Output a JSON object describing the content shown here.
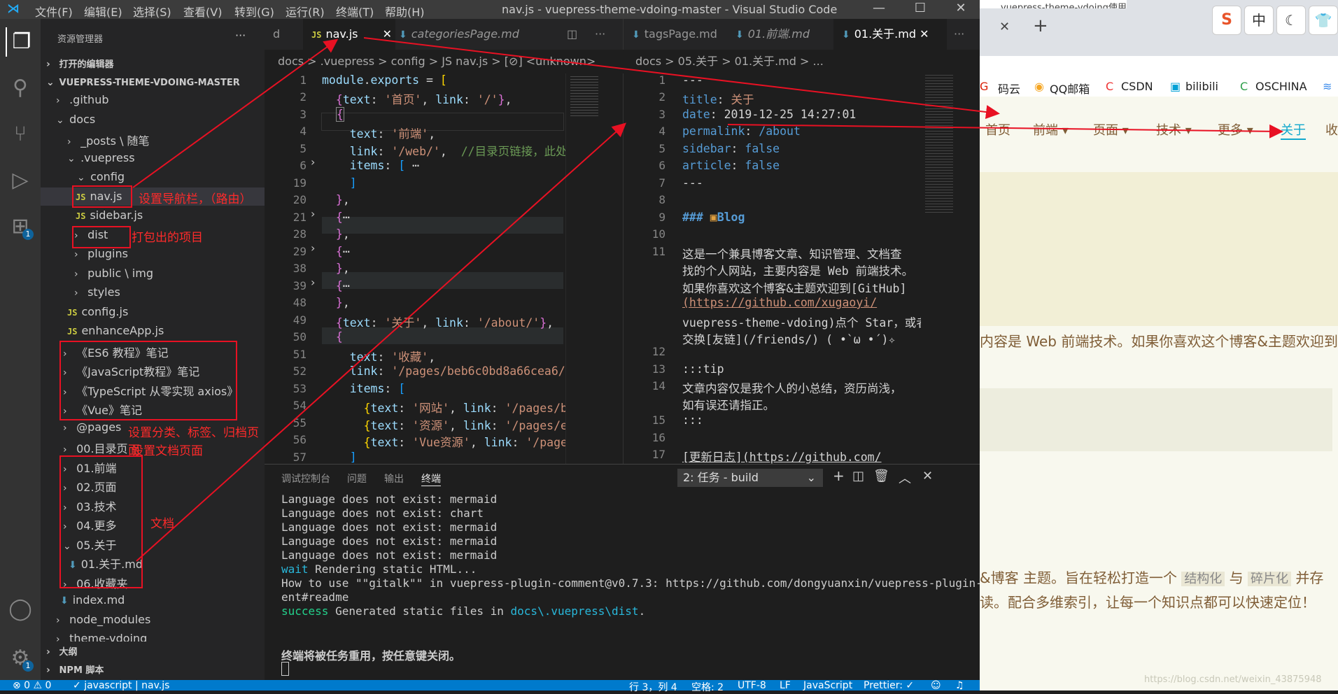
{
  "titlebar": {
    "menu": [
      "文件(F)",
      "编辑(E)",
      "选择(S)",
      "查看(V)",
      "转到(G)",
      "运行(R)",
      "终端(T)",
      "帮助(H)"
    ],
    "title": "nav.js - vuepress-theme-vdoing-master - Visual Studio Code"
  },
  "activity": {
    "icons": [
      "files-icon",
      "search-icon",
      "source-control-icon",
      "run-debug-icon",
      "extensions-icon",
      "account-icon",
      "settings-icon"
    ],
    "ext_badge": "1",
    "settings_badge": "1"
  },
  "sidebar": {
    "header": "资源管理器",
    "more": "···",
    "open_editors": "打开的编辑器",
    "root": "VUEPRESS-THEME-VDOING-MASTER",
    "items": [
      ".github",
      "docs",
      "_posts \\ 随笔",
      ".vuepress",
      "config",
      "nav.js",
      "sidebar.js",
      "dist",
      "plugins",
      "public \\ img",
      "styles",
      "config.js",
      "enhanceApp.js",
      "《ES6 教程》笔记",
      "《JavaScript教程》笔记",
      "《TypeScript 从零实现 axios》",
      "《Vue》笔记",
      "@pages",
      "00.目录页",
      "01.前端",
      "02.页面",
      "03.技术",
      "04.更多",
      "05.关于",
      "01.关于.md",
      "06.收藏夹",
      "index.md",
      "node_modules",
      "theme-vdoing"
    ],
    "outline": "大纲",
    "npm": "NPM 脚本"
  },
  "annotations": {
    "nav": "设置导航栏，（路由）",
    "dist": "打包出的项目",
    "pages": "设置分类、标签、归档页面",
    "catalog": "设置文档页面",
    "docs": "文档"
  },
  "editor1": {
    "tabs": [
      "d",
      "nav.js",
      "categoriesPage.md"
    ],
    "breadcrumb": "docs > .vuepress > config > JS nav.js > [⊘] <unknown>",
    "line_numbers": [
      "1",
      "2",
      "3",
      "4",
      "5",
      "6",
      "19",
      "20",
      "21",
      "28",
      "29",
      "38",
      "39",
      "48",
      "49",
      "50",
      "51",
      "52",
      "53",
      "54",
      "55",
      "56",
      "57"
    ]
  },
  "editor2": {
    "tabs": [
      "tagsPage.md",
      "01.前端.md",
      "01.关于.md"
    ],
    "breadcrumb": "docs > 05.关于 > 01.关于.md > ...",
    "line_numbers": [
      "1",
      "2",
      "3",
      "4",
      "5",
      "6",
      "7",
      "8",
      "9",
      "10",
      "11",
      "",
      "",
      "",
      "",
      "12",
      "13",
      "14",
      "",
      "15",
      "16",
      "17"
    ],
    "md": {
      "title": "关于",
      "date": "2019-12-25 14:27:01",
      "permalink": "/about",
      "heading": "Blog",
      "p1": "这是一个兼具博客文章、知识管理、文档查",
      "p2": "找的个人网站，主要内容是 Web 前端技术。",
      "p3": "如果你喜欢这个博客&主题欢迎到[GitHub]",
      "p4": "(https://github.com/xugaoyi/",
      "p5": "vuepress-theme-vdoing)点个 Star，或者",
      "p6": "交换[友链](/friends/) ( •̀ ω •́ )✧",
      "tip": ":::tip",
      "tip1": "文章内容仅是我个人的小总结，资历尚浅，",
      "tip2": "如有误还请指正。",
      "tipend": ":::",
      "log": "[更新日志](https://github.com/",
      "log2": "xugaoyi/vuepress-theme-vdoing/"
    }
  },
  "panel": {
    "tabs": [
      "调试控制台",
      "问题",
      "输出",
      "终端"
    ],
    "task": "2: 任务 - build",
    "lines": [
      "Language does not exist: mermaid",
      "Language does not exist: chart",
      "Language does not exist: mermaid",
      "Language does not exist: mermaid",
      "Language does not exist: mermaid"
    ],
    "wait": "wait",
    "wait_text": " Rendering static HTML...",
    "howto": "How to use \"\"gitalk\"\" in vuepress-plugin-comment@v0.7.3: https://github.com/dongyuanxin/vuepress-plugin-comm",
    "howto2": "ent#readme",
    "success": "success",
    "success_text": " Generated static files in ",
    "success_path": "docs\\.vuepress\\dist",
    "reuse": "终端将被任务重用，按任意键关闭。"
  },
  "status": {
    "errors": "⊗ 0 ⚠ 0",
    "file": "javascript | nav.js",
    "pos": "行 3，列 4",
    "spaces": "空格: 2",
    "enc": "UTF-8",
    "eol": "LF",
    "lang": "JavaScript",
    "prettier": "Prettier: ✓"
  },
  "browser": {
    "tab": "vuepress-theme-vdoing使用体验.md -",
    "bookmarks": [
      "码云",
      "QQ邮箱",
      "CSDN",
      "bilibili",
      "OSCHINA"
    ],
    "nav": [
      "首页",
      "前端",
      "页面",
      "技术",
      "更多",
      "关于",
      "收"
    ],
    "p1": "内容是 Web 前端技术。如果你喜欢这个博客&主题欢迎到",
    "p2a": "&博客 主题。旨在轻松打造一个",
    "p2b": "结构化",
    "p2c": "与",
    "p2d": "碎片化",
    "p2e": "并存",
    "p3": "读。配合多维索引，让每一个知识点都可以快速定位！",
    "watermark": "https://blog.csdn.net/weixin_43875948",
    "ime": [
      "S",
      "中"
    ]
  }
}
